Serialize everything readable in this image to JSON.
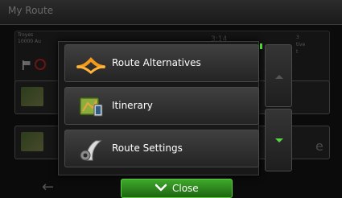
{
  "screen": {
    "title": "My Route",
    "destination": "Troyes\n10000 Au",
    "eta": "3:14",
    "right_info": "3\ntive\nt",
    "map_letter": "e"
  },
  "menu": {
    "items": [
      {
        "label": "Route Alternatives",
        "icon": "route-alternatives-icon"
      },
      {
        "label": "Itinerary",
        "icon": "itinerary-icon"
      },
      {
        "label": "Route Settings",
        "icon": "route-settings-icon"
      }
    ],
    "close_label": "Close"
  },
  "colors": {
    "accent_green": "#3ea92a",
    "indicator_green": "#4bd52e",
    "route_orange": "#f39a1b"
  }
}
